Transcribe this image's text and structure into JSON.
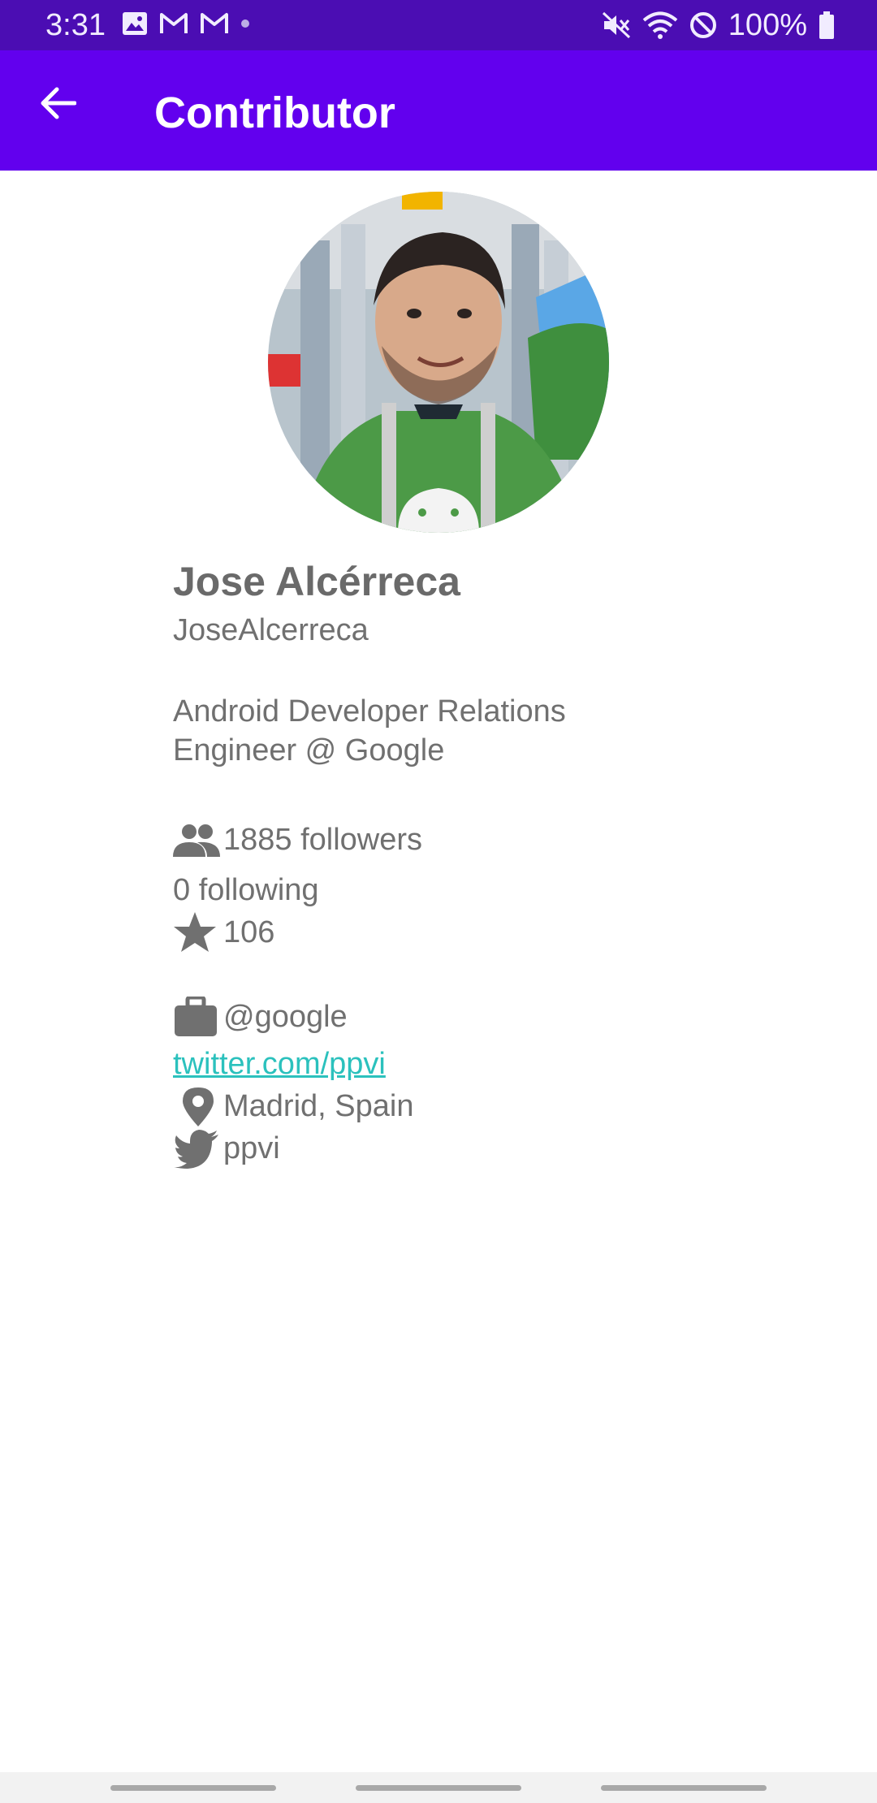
{
  "status_bar": {
    "time": "3:31",
    "battery": "100%",
    "left_icons": [
      "image-icon",
      "gmail-icon",
      "gmail-icon",
      "dot-icon"
    ],
    "right_icons": [
      "mute-icon",
      "wifi-icon",
      "do-not-disturb-icon",
      "battery-icon"
    ],
    "background": "#4b0db3"
  },
  "app_bar": {
    "title": "Contributor",
    "back_icon": "arrow-back-icon",
    "background": "#6200ee"
  },
  "profile": {
    "name": "Jose Alcérreca",
    "login": "JoseAlcerreca",
    "bio_line1": "Android Developer Relations",
    "bio_line2": "Engineer @ Google",
    "followers": "1885 followers",
    "following": "0 following",
    "stars": "106",
    "company": "@google",
    "blog": "twitter.com/ppvi",
    "location": "Madrid, Spain",
    "twitter": "ppvi"
  },
  "colors": {
    "text_gray": "#707070",
    "link": "#2bc1bd"
  }
}
